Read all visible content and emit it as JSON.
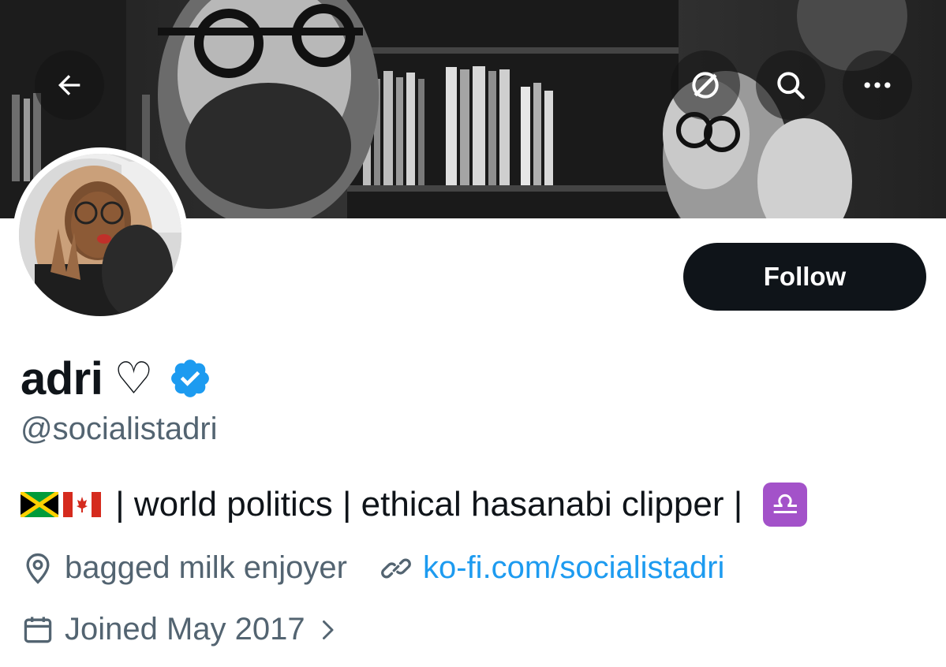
{
  "header": {
    "back_icon": "arrow-left-icon",
    "grok_icon": "grok-icon",
    "search_icon": "search-icon",
    "more_icon": "more-horizontal-icon"
  },
  "profile": {
    "display_name": "adri",
    "name_emoji": "♡",
    "verified": true,
    "handle": "@socialistadri",
    "follow_label": "Follow",
    "bio_text": " | world politics | ethical hasanabi clipper | ",
    "bio_flags": [
      "Jamaica",
      "Canada"
    ],
    "bio_zodiac": "♎",
    "location": "bagged milk enjoyer",
    "website": "ko-fi.com/socialistadri",
    "joined": "Joined May 2017"
  },
  "colors": {
    "accent": "#1d9bf0",
    "text": "#0f1419",
    "secondary": "#536471",
    "follow_bg": "#0f1419",
    "zodiac_bg": "#a352c9"
  }
}
